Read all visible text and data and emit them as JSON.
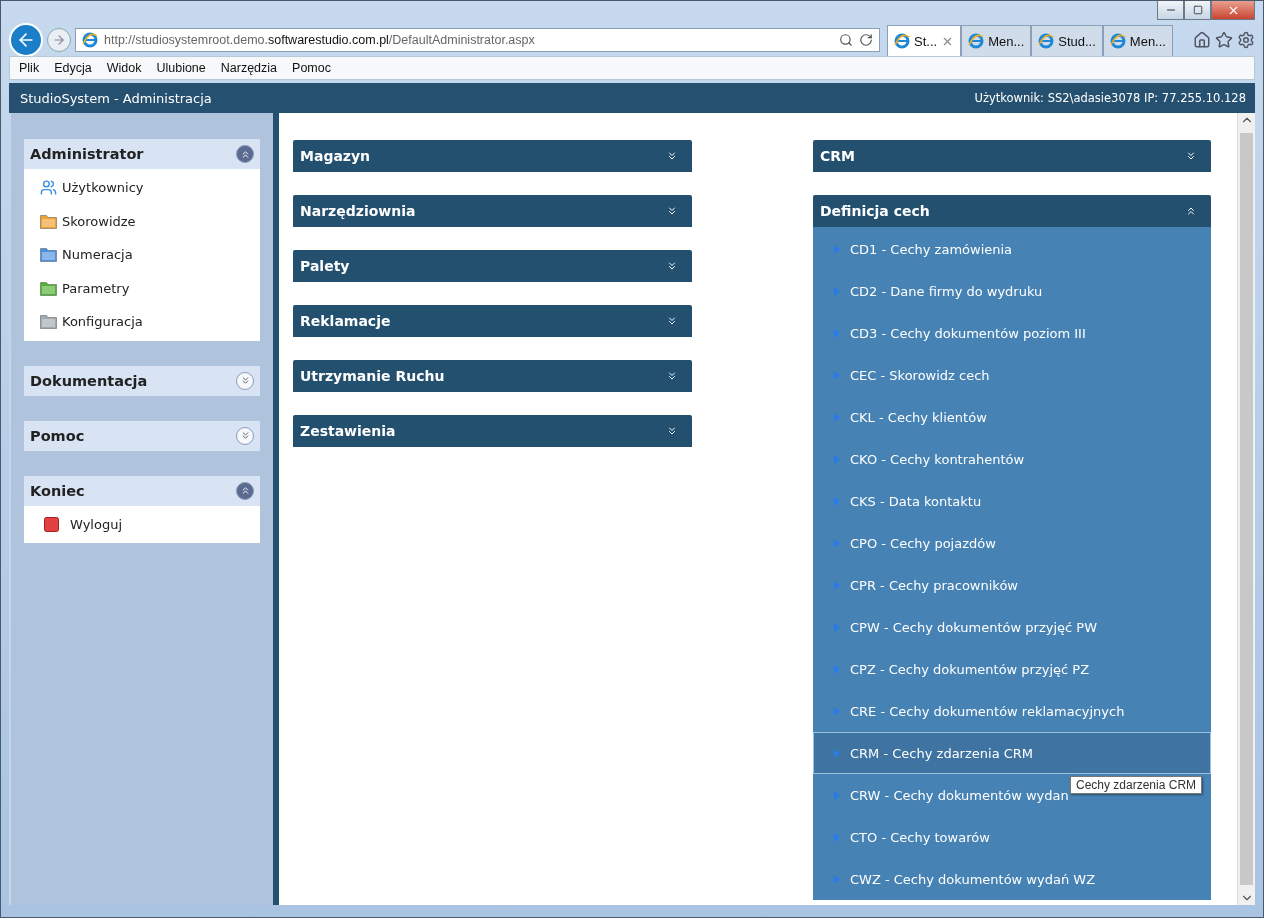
{
  "browser": {
    "url_prefix": "http://studiosystemroot.demo.",
    "url_host": "softwarestudio.com.pl",
    "url_path": "/DefaultAdministrator.aspx",
    "tabs": [
      {
        "label": "St...",
        "selected": true
      },
      {
        "label": "Men...",
        "selected": false
      },
      {
        "label": "Stud...",
        "selected": false
      },
      {
        "label": "Men...",
        "selected": false
      }
    ]
  },
  "menu": [
    "Plik",
    "Edycja",
    "Widok",
    "Ulubione",
    "Narzędzia",
    "Pomoc"
  ],
  "app": {
    "title": "StudioSystem - Administracja",
    "user_info": "Użytkownik: SS2\\adasie3078 IP: 77.255.10.128"
  },
  "sidebar": [
    {
      "title": "Administrator",
      "expanded": true,
      "items": [
        {
          "label": "Użytkownicy",
          "kind": "users",
          "color": "#3a8ee0"
        },
        {
          "label": "Skorowidze",
          "kind": "folder",
          "color": "#f0a030"
        },
        {
          "label": "Numeracja",
          "kind": "folder",
          "color": "#4a90e0"
        },
        {
          "label": "Parametry",
          "kind": "folder",
          "color": "#50b030"
        },
        {
          "label": "Konfiguracja",
          "kind": "folder",
          "color": "#a0a8b0"
        }
      ]
    },
    {
      "title": "Dokumentacja",
      "expanded": false
    },
    {
      "title": "Pomoc",
      "expanded": false
    },
    {
      "title": "Koniec",
      "expanded": true,
      "items": [
        {
          "label": "Wyloguj",
          "kind": "logout",
          "color": "#e04040"
        }
      ]
    }
  ],
  "left_panels": [
    {
      "title": "Magazyn",
      "expanded": false
    },
    {
      "title": "Narzędziownia",
      "expanded": false
    },
    {
      "title": "Palety",
      "expanded": false
    },
    {
      "title": "Reklamacje",
      "expanded": false
    },
    {
      "title": "Utrzymanie Ruchu",
      "expanded": false
    },
    {
      "title": "Zestawienia",
      "expanded": false
    }
  ],
  "right_panels": [
    {
      "title": "CRM",
      "expanded": false
    },
    {
      "title": "Definicja cech",
      "expanded": true,
      "items": [
        {
          "label": "CD1 - Cechy zamówienia",
          "selected": false
        },
        {
          "label": "CD2 - Dane firmy do wydruku",
          "selected": false
        },
        {
          "label": "CD3 - Cechy dokumentów poziom III",
          "selected": false
        },
        {
          "label": "CEC - Skorowidz cech",
          "selected": false
        },
        {
          "label": "CKL - Cechy klientów",
          "selected": false
        },
        {
          "label": "CKO - Cechy kontrahentów",
          "selected": false
        },
        {
          "label": "CKS - Data kontaktu",
          "selected": false
        },
        {
          "label": "CPO - Cechy pojazdów",
          "selected": false
        },
        {
          "label": "CPR - Cechy pracowników",
          "selected": false
        },
        {
          "label": "CPW - Cechy dokumentów przyjęć PW",
          "selected": false
        },
        {
          "label": "CPZ - Cechy dokumentów przyjęć PZ",
          "selected": false
        },
        {
          "label": "CRE - Cechy dokumentów reklamacyjnych",
          "selected": false
        },
        {
          "label": "CRM - Cechy zdarzenia CRM",
          "selected": true,
          "tooltip": "Cechy zdarzenia CRM"
        },
        {
          "label": "CRW - Cechy dokumentów wydan",
          "selected": false
        },
        {
          "label": "CTO - Cechy towarów",
          "selected": false
        },
        {
          "label": "CWZ - Cechy dokumentów wydań WZ",
          "selected": false
        }
      ]
    }
  ]
}
